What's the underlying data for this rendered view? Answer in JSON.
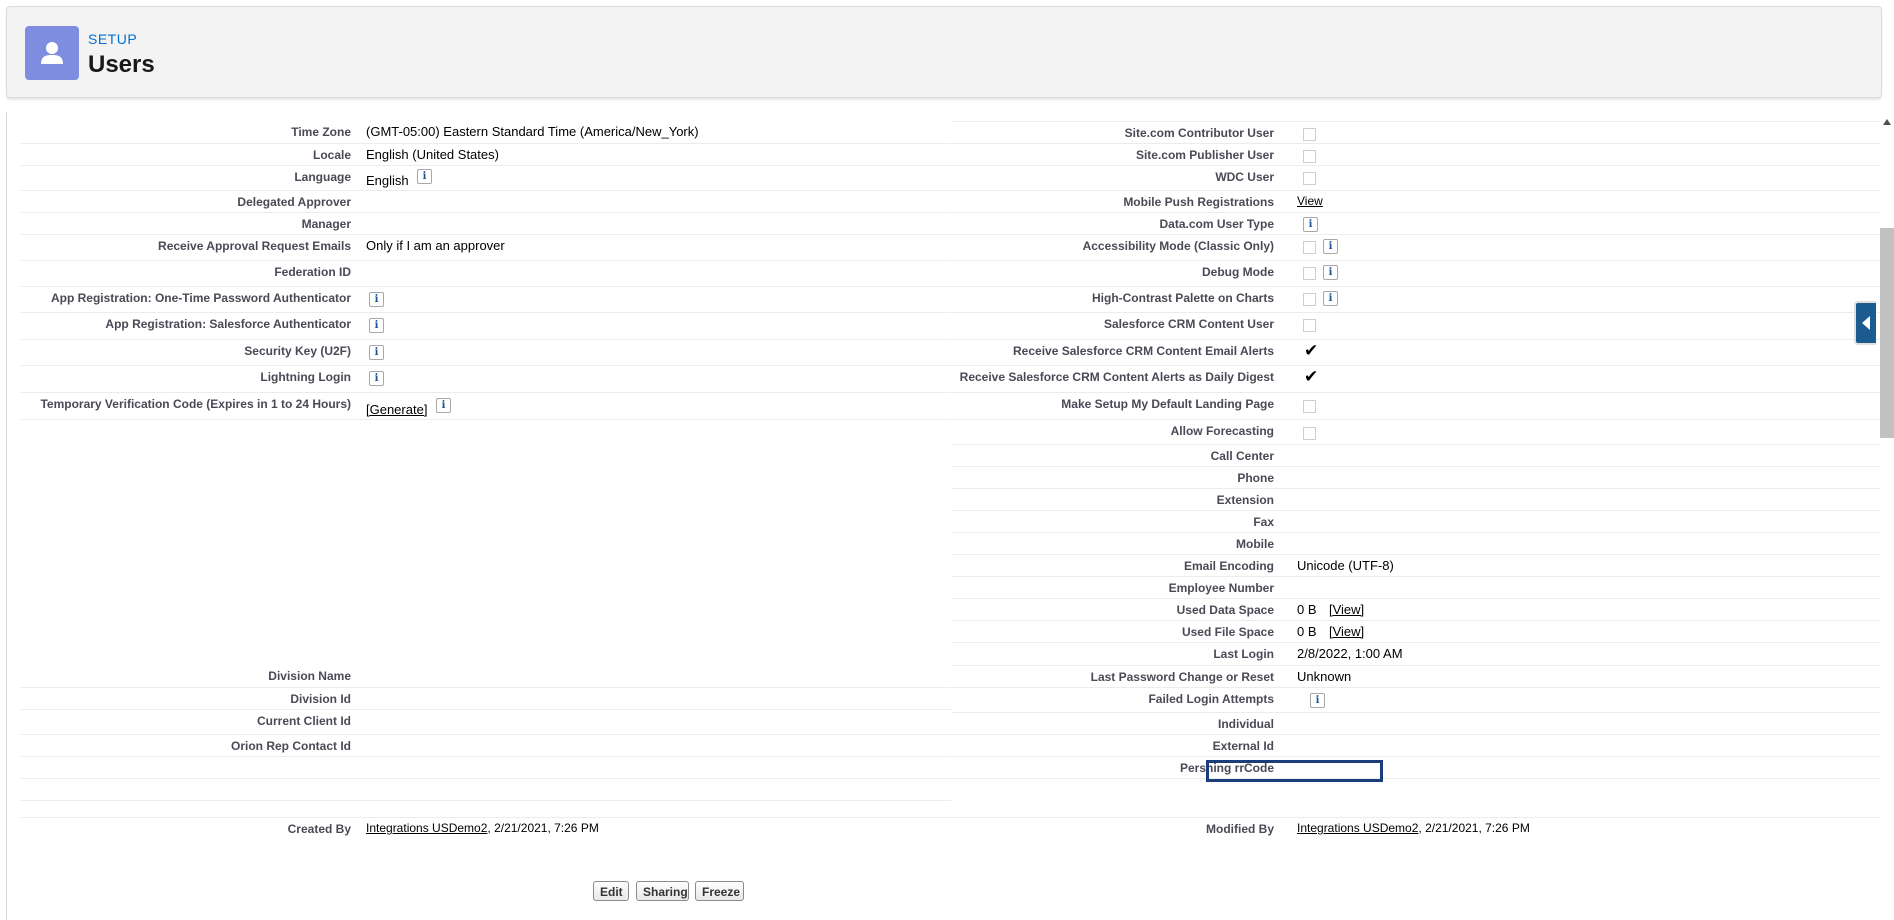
{
  "header": {
    "breadcrumb": "SETUP",
    "title": "Users",
    "icon": "user-icon",
    "icon_color": "#7f8de1"
  },
  "left_fields": [
    {
      "label": "Time Zone",
      "value": "(GMT-05:00) Eastern Standard Time (America/New_York)"
    },
    {
      "label": "Locale",
      "value": "English (United States)"
    },
    {
      "label": "Language",
      "value": "English"
    },
    {
      "label": "Delegated Approver",
      "value": ""
    },
    {
      "label": "Manager",
      "value": ""
    },
    {
      "label": "Receive Approval Request Emails",
      "value": "Only if I am an approver"
    },
    {
      "label": "Federation ID",
      "value": ""
    },
    {
      "label": "App Registration: One-Time Password Authenticator",
      "value": ""
    },
    {
      "label": "App Registration: Salesforce Authenticator",
      "value": ""
    },
    {
      "label": "Security Key (U2F)",
      "value": ""
    },
    {
      "label": "Lightning Login",
      "value": ""
    },
    {
      "label": "Temporary Verification Code (Expires in 1 to 24 Hours)",
      "value": "[Generate]"
    },
    {
      "label": "Division Name",
      "value": ""
    },
    {
      "label": "Division Id",
      "value": ""
    },
    {
      "label": "Current Client Id",
      "value": ""
    },
    {
      "label": "Orion Rep Contact Id",
      "value": ""
    }
  ],
  "right_fields": [
    {
      "label": "Site.com Contributor User",
      "value": ""
    },
    {
      "label": "Site.com Publisher User",
      "value": ""
    },
    {
      "label": "WDC User",
      "value": ""
    },
    {
      "label": "Mobile Push Registrations",
      "value": "View"
    },
    {
      "label": "Data.com User Type",
      "value": ""
    },
    {
      "label": "Accessibility Mode (Classic Only)",
      "value": ""
    },
    {
      "label": "Debug Mode",
      "value": ""
    },
    {
      "label": "High-Contrast Palette on Charts",
      "value": ""
    },
    {
      "label": "Salesforce CRM Content User",
      "value": ""
    },
    {
      "label": "Receive Salesforce CRM Content Email Alerts",
      "value": "✔"
    },
    {
      "label": "Receive Salesforce CRM Content Alerts as Daily Digest",
      "value": "✔"
    },
    {
      "label": "Make Setup My Default Landing Page",
      "value": ""
    },
    {
      "label": "Allow Forecasting",
      "value": ""
    },
    {
      "label": "Call Center",
      "value": ""
    },
    {
      "label": "Phone",
      "value": ""
    },
    {
      "label": "Extension",
      "value": ""
    },
    {
      "label": "Fax",
      "value": ""
    },
    {
      "label": "Mobile",
      "value": ""
    },
    {
      "label": "Email Encoding",
      "value": "Unicode (UTF-8)"
    },
    {
      "label": "Employee Number",
      "value": ""
    },
    {
      "label": "Used Data Space",
      "value": "0 B",
      "link": "[View]"
    },
    {
      "label": "Used File Space",
      "value": "0 B",
      "link": "[View]"
    },
    {
      "label": "Last Login",
      "value": "2/8/2022, 1:00 AM"
    },
    {
      "label": "Last Password Change or Reset",
      "value": "Unknown"
    },
    {
      "label": "Failed Login Attempts",
      "value": ""
    },
    {
      "label": "Individual",
      "value": ""
    },
    {
      "label": "External Id",
      "value": ""
    },
    {
      "label": "Pershing rrCode",
      "value": ""
    }
  ],
  "created_by": {
    "label": "Created By",
    "user": "Integrations USDemo2",
    "date": ", 2/21/2021, 7:26 PM"
  },
  "modified_by": {
    "label": "Modified By",
    "user": "Integrations USDemo2",
    "date": ", 2/21/2021, 7:26 PM"
  },
  "buttons": {
    "edit": "Edit",
    "sharing": "Sharing",
    "freeze": "Freeze"
  },
  "info_glyph": "i",
  "colors": {
    "highlight_border": "#1b3e7a",
    "side_tab": "#1b5b8f",
    "link": "#0070d2"
  }
}
